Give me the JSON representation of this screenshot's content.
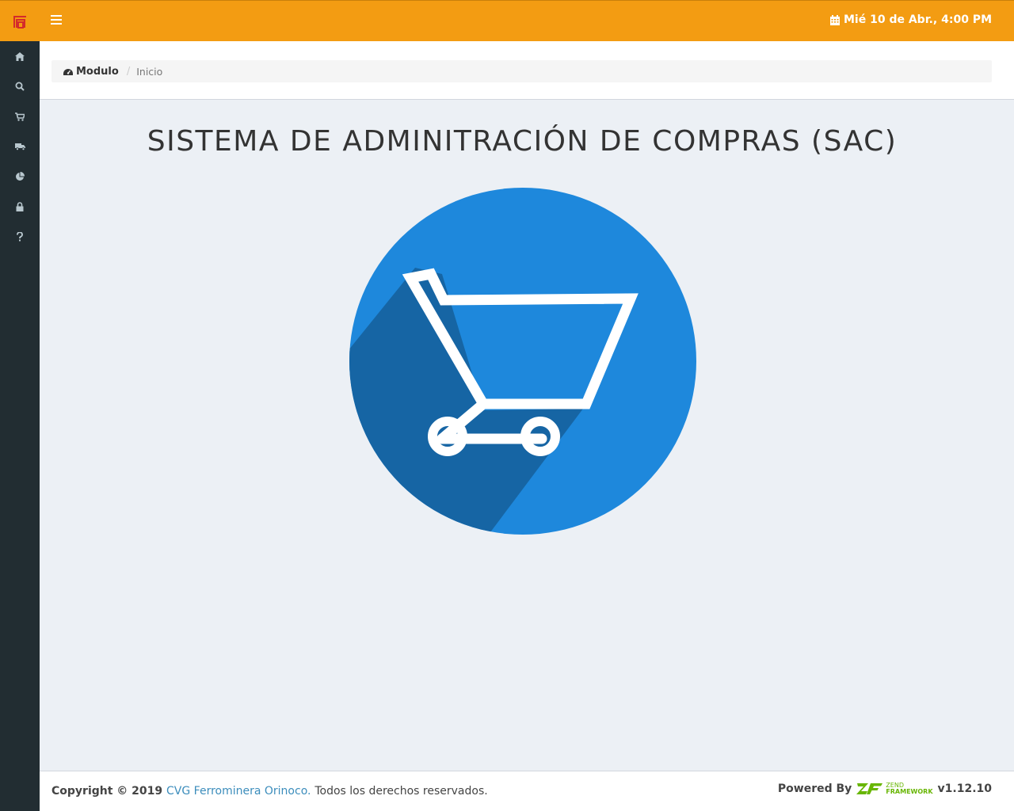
{
  "topbar": {
    "datetime": "Mié 10 de Abr., 4:00 PM"
  },
  "sidebar": {
    "items": [
      {
        "icon": "home-icon"
      },
      {
        "icon": "search-icon"
      },
      {
        "icon": "cart-icon"
      },
      {
        "icon": "truck-icon"
      },
      {
        "icon": "pie-chart-icon"
      },
      {
        "icon": "lock-icon"
      },
      {
        "icon": "question-icon"
      }
    ]
  },
  "breadcrumb": {
    "module": "Modulo",
    "current": "Inicio"
  },
  "main": {
    "title": "SISTEMA DE ADMINITRACIÓN DE COMPRAS (SAC)"
  },
  "footer": {
    "copyright": "Copyright © 2019",
    "company": "CVG Ferrominera Orinoco.",
    "rights": "Todos los derechos reservados.",
    "powered_by": "Powered By",
    "zend": "ZEND",
    "framework": "FRAMEWORK",
    "version": "v1.12.10"
  },
  "colors": {
    "accent": "#f39c12",
    "sidebar": "#222d32",
    "link": "#3c8dbc",
    "logo_blue": "#1e88dc",
    "logo_shadow": "#1665a4"
  }
}
